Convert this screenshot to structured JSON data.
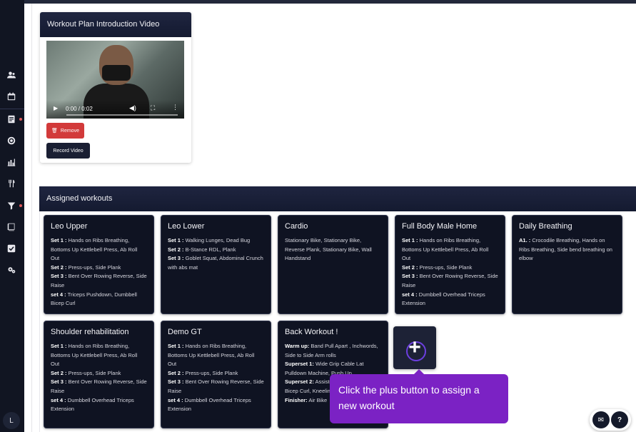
{
  "sidebar": {
    "icons": [
      "users-icon",
      "calendar-icon",
      "clipboard-icon",
      "target-icon",
      "bar-chart-icon",
      "utensils-icon",
      "funnel-icon",
      "book-icon",
      "checklist-icon",
      "settings-icon"
    ],
    "avatar_initial": "L"
  },
  "video_card": {
    "title": "Workout Plan Introduction Video",
    "time": "0:00 / 0:02",
    "remove_label": "Remove",
    "record_label": "Record Video"
  },
  "assigned": {
    "title": "Assigned workouts",
    "workouts": [
      {
        "title": "Leo Upper",
        "lines": [
          {
            "label": "Set 1 :",
            "text": "Hands on Ribs Breathing, Bottoms Up Kettlebell Press, Ab Roll Out"
          },
          {
            "label": "Set 2 :",
            "text": "Press-ups, Side Plank"
          },
          {
            "label": "Set 3 :",
            "text": "Bent Over Rowing Reverse, Side Raise"
          },
          {
            "label": "set 4 :",
            "text": "Triceps Pushdown, Dumbbell Bicep Curl"
          }
        ]
      },
      {
        "title": "Leo Lower",
        "lines": [
          {
            "label": "Set 1 :",
            "text": "Walking Lunges, Dead Bug"
          },
          {
            "label": "Set 2 :",
            "text": "B-Stance RDL, Plank"
          },
          {
            "label": "Set 3 :",
            "text": "Goblet Squat, Abdominal Crunch with abs mat"
          }
        ]
      },
      {
        "title": "Cardio",
        "lines": [
          {
            "label": "",
            "text": "Stationary Bike, Stationary Bike, Reverse Plank, Stationary Bike, Wall Handstand"
          }
        ]
      },
      {
        "title": "Full Body Male Home",
        "lines": [
          {
            "label": "Set 1 :",
            "text": "Hands on Ribs Breathing, Bottoms Up Kettlebell Press, Ab Roll Out"
          },
          {
            "label": "Set 2 :",
            "text": "Press-ups, Side Plank"
          },
          {
            "label": "Set 3 :",
            "text": "Bent Over Rowing Reverse, Side Raise"
          },
          {
            "label": "set 4 :",
            "text": "Dumbbell Overhead Triceps Extension"
          }
        ]
      },
      {
        "title": "Daily Breathing",
        "lines": [
          {
            "label": "A1. :",
            "text": "Crocodile Breathing, Hands on Ribs Breathing, Side bend breathing on elbow"
          }
        ]
      },
      {
        "title": "Shoulder rehabilitation",
        "lines": [
          {
            "label": "Set 1 :",
            "text": "Hands on Ribs Breathing, Bottoms Up Kettlebell Press, Ab Roll Out"
          },
          {
            "label": "Set 2 :",
            "text": "Press-ups, Side Plank"
          },
          {
            "label": "Set 3 :",
            "text": "Bent Over Rowing Reverse, Side Raise"
          },
          {
            "label": "set 4 :",
            "text": "Dumbbell Overhead Triceps Extension"
          }
        ]
      },
      {
        "title": "Demo GT",
        "lines": [
          {
            "label": "Set 1 :",
            "text": "Hands on Ribs Breathing, Bottoms Up Kettlebell Press, Ab Roll Out"
          },
          {
            "label": "Set 2 :",
            "text": "Press-ups, Side Plank"
          },
          {
            "label": "Set 3 :",
            "text": "Bent Over Rowing Reverse, Side Raise"
          },
          {
            "label": "set 4 :",
            "text": "Dumbbell Overhead Triceps Extension"
          }
        ]
      },
      {
        "title": "Back Workout !",
        "lines": [
          {
            "label": "Warm up:",
            "text": "Band Pull Apart , Inchwords, Side to Side Arm rolls"
          },
          {
            "label": "Superset 1:",
            "text": "Wide Grip Cable Lat Pulldown Machine, Push Up"
          },
          {
            "label": "Superset 2:",
            "text": "Assisted Pull-Up Machine, Bicep Curl, Kneeling Dumbbell Row"
          },
          {
            "label": "Finisher:",
            "text": "Air Bike"
          }
        ]
      }
    ]
  },
  "tooltip": {
    "text": "Click the plus button to assign a new workout"
  },
  "fab": {
    "mail_icon": "envelope-icon",
    "help_label": "?"
  },
  "colors": {
    "header_navy": "#1a2035",
    "accent_purple": "#7b22c4",
    "danger_red": "#d23a3a"
  }
}
